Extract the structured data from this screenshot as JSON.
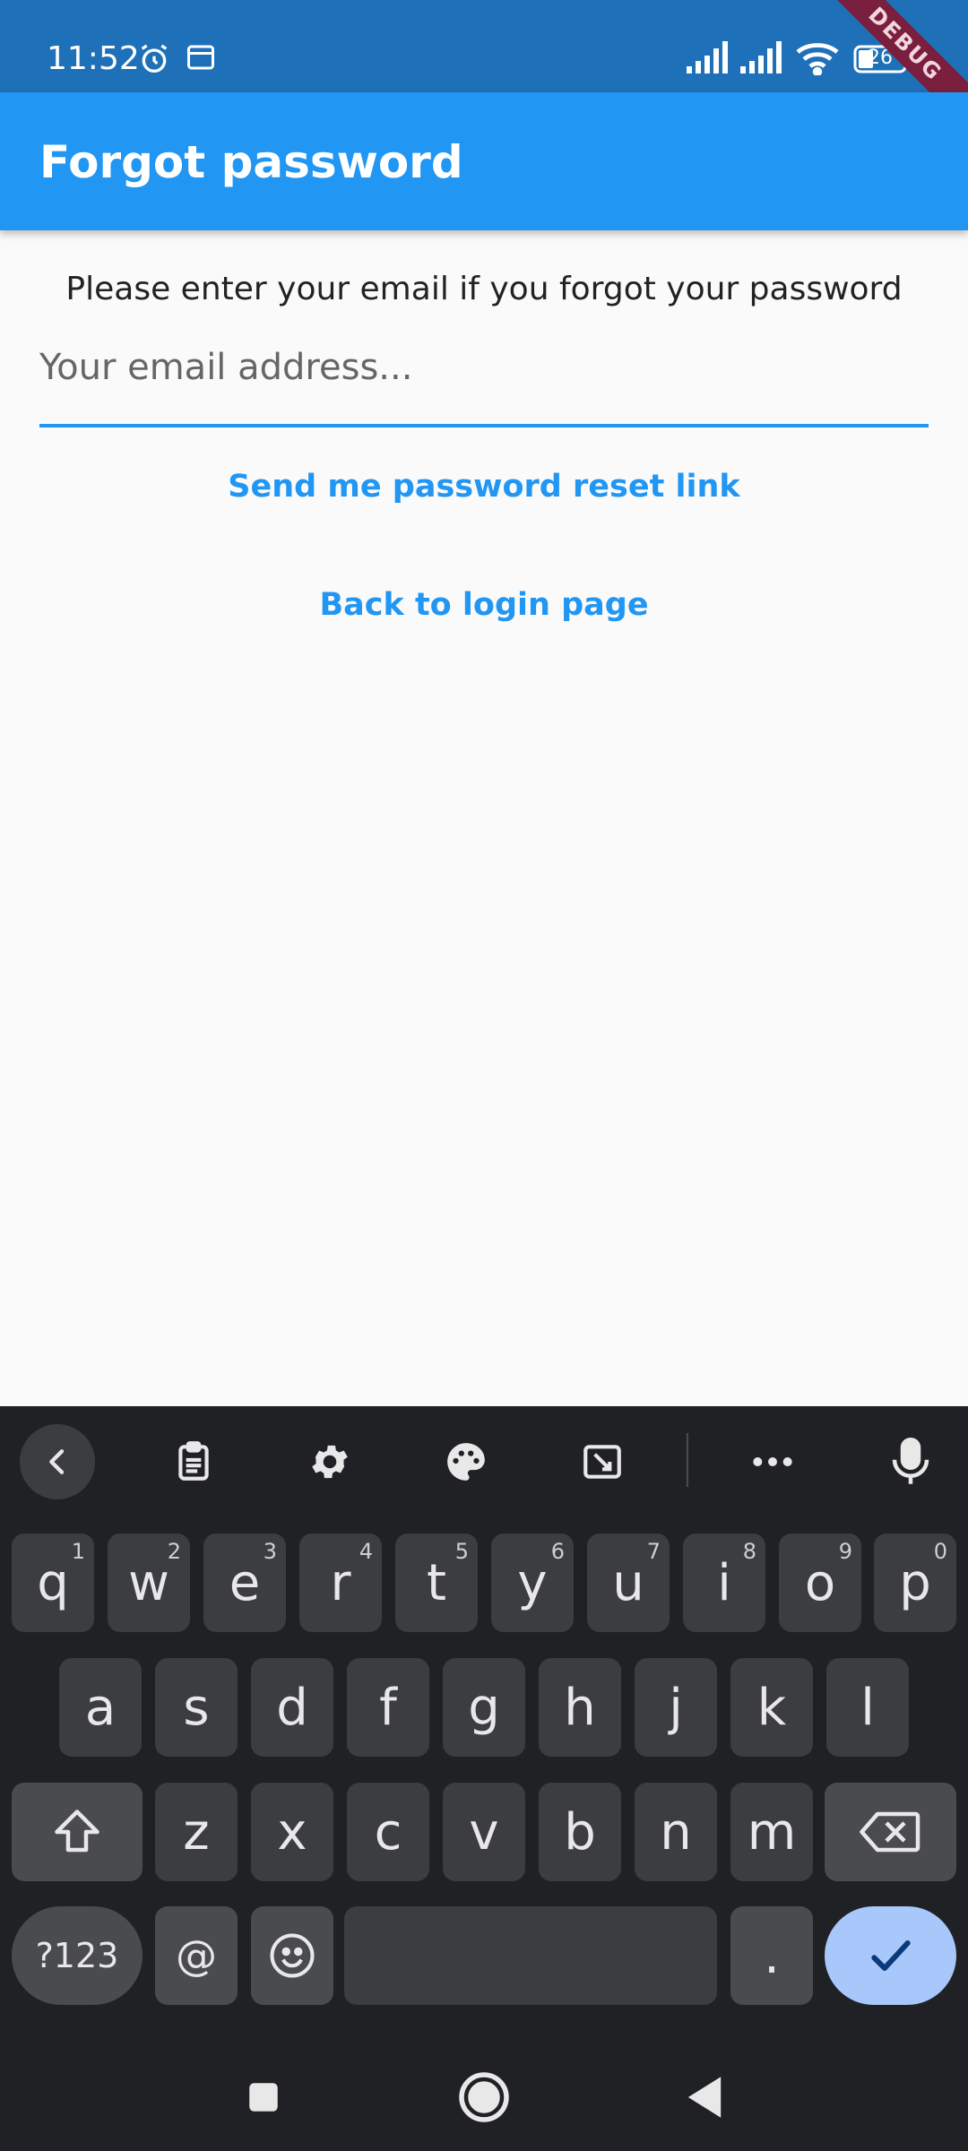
{
  "status_bar": {
    "time": "11:52",
    "battery": "26",
    "debug_label": "DEBUG"
  },
  "app_bar": {
    "title": "Forgot password"
  },
  "form": {
    "prompt": "Please enter your email if you forgot your password",
    "email_placeholder": "Your email address...",
    "email_value": "",
    "send_label": "Send me password reset link",
    "back_label": "Back to login page"
  },
  "keyboard": {
    "row1": [
      {
        "k": "q",
        "n": "1"
      },
      {
        "k": "w",
        "n": "2"
      },
      {
        "k": "e",
        "n": "3"
      },
      {
        "k": "r",
        "n": "4"
      },
      {
        "k": "t",
        "n": "5"
      },
      {
        "k": "y",
        "n": "6"
      },
      {
        "k": "u",
        "n": "7"
      },
      {
        "k": "i",
        "n": "8"
      },
      {
        "k": "o",
        "n": "9"
      },
      {
        "k": "p",
        "n": "0"
      }
    ],
    "row2": [
      "a",
      "s",
      "d",
      "f",
      "g",
      "h",
      "j",
      "k",
      "l"
    ],
    "row3": [
      "z",
      "x",
      "c",
      "v",
      "b",
      "n",
      "m"
    ],
    "symbols_label": "?123",
    "at_label": "@",
    "period_label": ".",
    "toolbar_icons": [
      "back-icon",
      "clipboard-icon",
      "gear-icon",
      "palette-icon",
      "floating-keyboard-icon",
      "more-icon",
      "microphone-icon"
    ]
  },
  "colors": {
    "status_bar": "#1e70b8",
    "app_bar": "#2196f3",
    "accent": "#2196f3",
    "keyboard_bg": "#202124",
    "key_bg": "#3c3d40",
    "enter_key": "#a8c7fa"
  }
}
